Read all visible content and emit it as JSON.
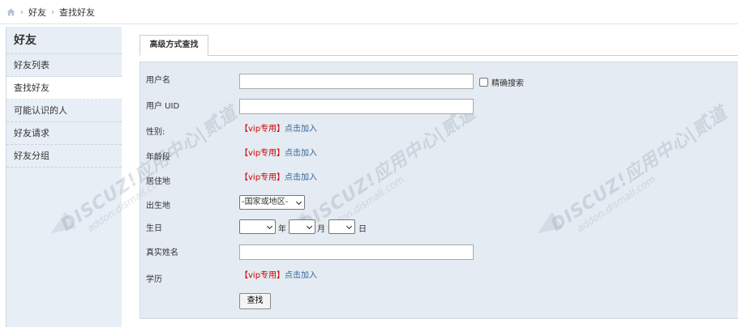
{
  "breadcrumb": {
    "home_icon": "home-icon",
    "items": [
      "好友",
      "查找好友"
    ]
  },
  "sidebar": {
    "title": "好友",
    "items": [
      {
        "label": "好友列表"
      },
      {
        "label": "查找好友"
      },
      {
        "label": "可能认识的人"
      },
      {
        "label": "好友请求"
      },
      {
        "label": "好友分组"
      }
    ]
  },
  "tab": {
    "label": "高级方式查找"
  },
  "watermark": {
    "text": "DISCUZ!应用中心|贰道",
    "sub": "addon.dismall.com"
  },
  "form": {
    "username": {
      "label": "用户名",
      "value": ""
    },
    "exact": {
      "label": "精确搜索",
      "checked": false
    },
    "uid": {
      "label": "用户 UID",
      "value": ""
    },
    "gender": {
      "label": "性别:",
      "tag": "【vip专用】",
      "link": "点击加入"
    },
    "age": {
      "label": "年龄段",
      "tag": "【vip专用】",
      "link": "点击加入"
    },
    "residence": {
      "label": "居住地",
      "tag": "【vip专用】",
      "link": "点击加入"
    },
    "birthplace": {
      "label": "出生地",
      "selected": "-国家或地区-"
    },
    "birthday": {
      "label": "生日",
      "year_unit": "年",
      "month_unit": "月",
      "day_unit": "日",
      "year": "",
      "month": "",
      "day": ""
    },
    "realname": {
      "label": "真实姓名",
      "value": ""
    },
    "education": {
      "label": "学历",
      "tag": "【vip专用】",
      "link": "点击加入"
    },
    "search_button": "查找"
  },
  "colors": {
    "sidebar_bg": "#e7eef6",
    "panel_bg": "#e4ebf2",
    "vip_red": "#d40000",
    "link_blue": "#336699"
  }
}
